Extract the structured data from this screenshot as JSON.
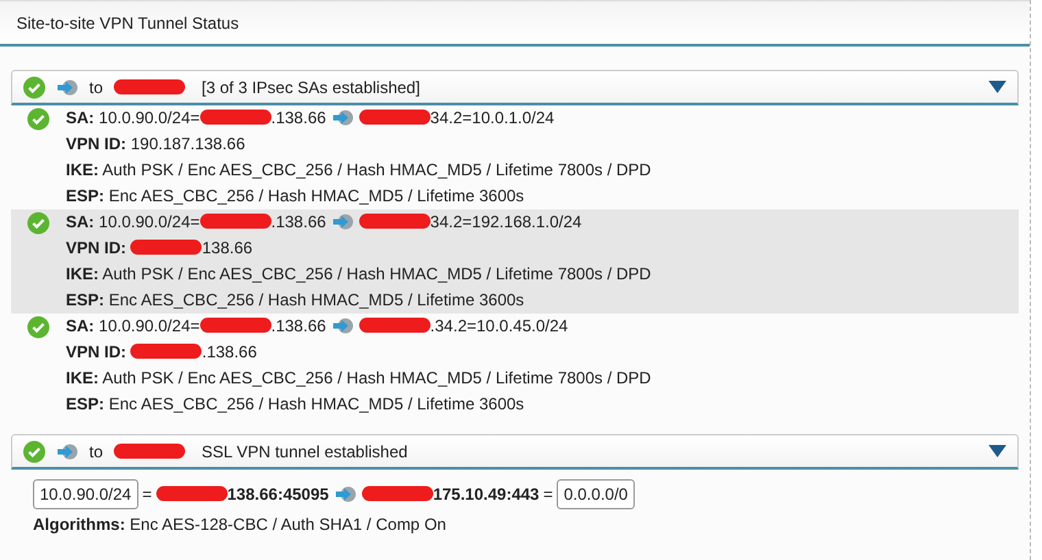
{
  "title": "Site-to-site VPN Tunnel Status",
  "tunnels": [
    {
      "established": true,
      "expanded": true,
      "prefix": "to",
      "summary": "[3 of 3 IPsec SAs established]",
      "kind": "ipsec",
      "sas": [
        {
          "established": true,
          "selected": false,
          "lines": [
            {
              "label": "SA:",
              "parts": [
                {
                  "kind": "text",
                  "text": "10.0.90.0/24="
                },
                {
                  "kind": "redaction"
                },
                {
                  "kind": "text",
                  "text": ".138.66"
                },
                {
                  "kind": "arrow"
                },
                {
                  "kind": "redaction"
                },
                {
                  "kind": "text",
                  "text": "34.2=10.0.1.0/24"
                }
              ]
            },
            {
              "label": "VPN ID:",
              "parts": [
                {
                  "kind": "text",
                  "text": "190.187.138.66"
                }
              ]
            },
            {
              "label": "IKE:",
              "parts": [
                {
                  "kind": "text",
                  "text": "Auth PSK / Enc AES_CBC_256 / Hash HMAC_MD5 / Lifetime 7800s / DPD"
                }
              ]
            },
            {
              "label": "ESP:",
              "parts": [
                {
                  "kind": "text",
                  "text": "Enc AES_CBC_256 / Hash HMAC_MD5 / Lifetime 3600s"
                }
              ]
            }
          ]
        },
        {
          "established": true,
          "selected": true,
          "lines": [
            {
              "label": "SA:",
              "parts": [
                {
                  "kind": "text",
                  "text": "10.0.90.0/24="
                },
                {
                  "kind": "redaction"
                },
                {
                  "kind": "text",
                  "text": ".138.66"
                },
                {
                  "kind": "arrow"
                },
                {
                  "kind": "redaction"
                },
                {
                  "kind": "text",
                  "text": "34.2=192.168.1.0/24"
                }
              ]
            },
            {
              "label": "VPN ID:",
              "parts": [
                {
                  "kind": "redaction"
                },
                {
                  "kind": "text",
                  "text": "138.66"
                }
              ]
            },
            {
              "label": "IKE:",
              "parts": [
                {
                  "kind": "text",
                  "text": "Auth PSK / Enc AES_CBC_256 / Hash HMAC_MD5 / Lifetime 7800s / DPD"
                }
              ]
            },
            {
              "label": "ESP:",
              "parts": [
                {
                  "kind": "text",
                  "text": "Enc AES_CBC_256 / Hash HMAC_MD5 / Lifetime 3600s"
                }
              ]
            }
          ]
        },
        {
          "established": true,
          "selected": false,
          "lines": [
            {
              "label": "SA:",
              "parts": [
                {
                  "kind": "text",
                  "text": "10.0.90.0/24="
                },
                {
                  "kind": "redaction"
                },
                {
                  "kind": "text",
                  "text": ".138.66"
                },
                {
                  "kind": "arrow"
                },
                {
                  "kind": "redaction"
                },
                {
                  "kind": "text",
                  "text": ".34.2=10.0.45.0/24"
                }
              ]
            },
            {
              "label": "VPN ID:",
              "parts": [
                {
                  "kind": "redaction"
                },
                {
                  "kind": "text",
                  "text": ".138.66"
                }
              ]
            },
            {
              "label": "IKE:",
              "parts": [
                {
                  "kind": "text",
                  "text": "Auth PSK / Enc AES_CBC_256 / Hash HMAC_MD5 / Lifetime 7800s / DPD"
                }
              ]
            },
            {
              "label": "ESP:",
              "parts": [
                {
                  "kind": "text",
                  "text": "Enc AES_CBC_256 / Hash HMAC_MD5 / Lifetime 3600s"
                }
              ]
            }
          ]
        }
      ]
    },
    {
      "established": true,
      "expanded": true,
      "prefix": "to",
      "summary": "SSL VPN tunnel established",
      "kind": "ssl",
      "route": [
        {
          "kind": "field",
          "text": "10.0.90.0/24"
        },
        {
          "kind": "text",
          "text": "="
        },
        {
          "kind": "redaction"
        },
        {
          "kind": "strong",
          "text": "138.66:45095"
        },
        {
          "kind": "arrow"
        },
        {
          "kind": "redaction"
        },
        {
          "kind": "strong",
          "text": "175.10.49:443"
        },
        {
          "kind": "text",
          "text": "="
        },
        {
          "kind": "field",
          "text": "0.0.0.0/0"
        }
      ],
      "algorithms": {
        "label": "Algorithms:",
        "text": "Enc AES-128-CBC / Auth SHA1 / Comp On"
      }
    }
  ]
}
